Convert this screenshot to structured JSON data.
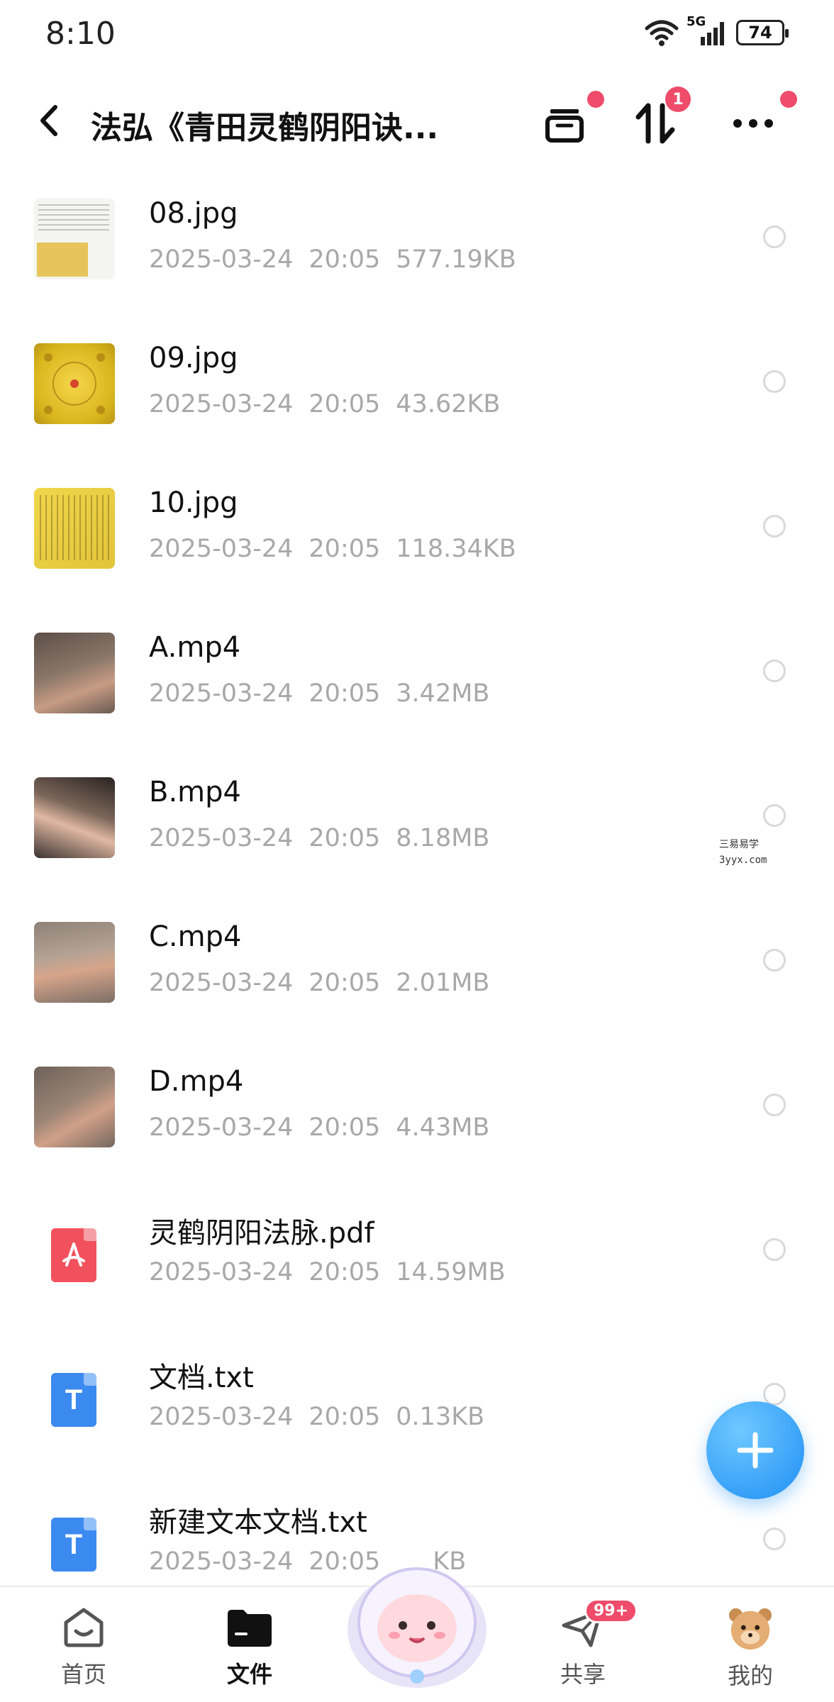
{
  "status_bar": {
    "time": "8:10",
    "network": "5G",
    "battery": "74"
  },
  "header": {
    "title": "法弘《青田灵鹤阴阳诀...",
    "sort_badge": "1"
  },
  "files": [
    {
      "name": "08.jpg",
      "date": "2025-03-24",
      "time": "20:05",
      "size": "577.19KB",
      "thumb": "doc-scan"
    },
    {
      "name": "09.jpg",
      "date": "2025-03-24",
      "time": "20:05",
      "size": "43.62KB",
      "thumb": "gold-diagram"
    },
    {
      "name": "10.jpg",
      "date": "2025-03-24",
      "time": "20:05",
      "size": "118.34KB",
      "thumb": "gold-text"
    },
    {
      "name": "A.mp4",
      "date": "2025-03-24",
      "time": "20:05",
      "size": "3.42MB",
      "thumb": "hand-video"
    },
    {
      "name": "B.mp4",
      "date": "2025-03-24",
      "time": "20:05",
      "size": "8.18MB",
      "thumb": "hand-video"
    },
    {
      "name": "C.mp4",
      "date": "2025-03-24",
      "time": "20:05",
      "size": "2.01MB",
      "thumb": "hand-video"
    },
    {
      "name": "D.mp4",
      "date": "2025-03-24",
      "time": "20:05",
      "size": "4.43MB",
      "thumb": "hand-video"
    },
    {
      "name": "灵鹤阴阳法脉.pdf",
      "date": "2025-03-24",
      "time": "20:05",
      "size": "14.59MB",
      "thumb": "pdf-icon"
    },
    {
      "name": "文档.txt",
      "date": "2025-03-24",
      "time": "20:05",
      "size": "0.13KB",
      "thumb": "txt-icon"
    },
    {
      "name": "新建文本文档.txt",
      "date": "2025-03-24",
      "time": "20:05",
      "size": "KB",
      "thumb": "txt-icon"
    }
  ],
  "txt_icon_letter": "T",
  "watermark": {
    "line1": "三易易学",
    "line2": "3yyx.com"
  },
  "bottom_nav": {
    "home": "首页",
    "files": "文件",
    "share": "共享",
    "share_badge": "99+",
    "mine": "我的"
  },
  "colors": {
    "accent_red": "#ee4c6a",
    "fab_blue": "#1e8ff5",
    "pdf_red": "#f1515d",
    "txt_blue": "#3b8af0",
    "meta_gray": "#a8a8a8"
  }
}
